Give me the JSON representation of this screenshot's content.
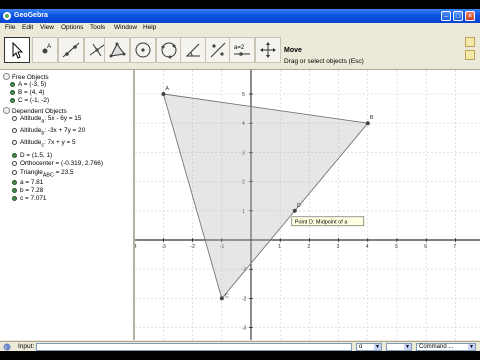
{
  "window": {
    "title": "GeoGebra"
  },
  "menu": [
    "File",
    "Edit",
    "View",
    "Options",
    "Tools",
    "Window",
    "Help"
  ],
  "toolbar": {
    "tools": [
      {
        "name": "move-tool",
        "icon": "arrow-cursor-icon"
      },
      {
        "name": "point-tool",
        "icon": "point-icon"
      },
      {
        "name": "line-tool",
        "icon": "line-through-points-icon"
      },
      {
        "name": "perpendicular-tool",
        "icon": "perpendicular-line-icon"
      },
      {
        "name": "polygon-tool",
        "icon": "polygon-icon"
      },
      {
        "name": "circle-tool",
        "icon": "circle-center-point-icon"
      },
      {
        "name": "circle-arc-tool",
        "icon": "circle-three-points-icon"
      },
      {
        "name": "angle-tool",
        "icon": "angle-icon"
      },
      {
        "name": "reflect-tool",
        "icon": "reflect-about-line-icon"
      },
      {
        "name": "slider-tool",
        "icon": "slider-icon"
      },
      {
        "name": "move-view-tool",
        "icon": "move-graphics-view-icon"
      }
    ],
    "active_title": "Move",
    "active_desc": "Drag or select objects (Esc)"
  },
  "algebra": {
    "free_header": "Free Objects",
    "free": [
      {
        "label": "A",
        "value": "(-3, 5)"
      },
      {
        "label": "B",
        "value": "(4, 4)"
      },
      {
        "label": "C",
        "value": "(-1, -2)"
      }
    ],
    "dependent_header": "Dependent Objects",
    "dependent": [
      {
        "name": "Altitude",
        "sub": "a",
        "eq": ": 5x - 6y = 15",
        "shown": false
      },
      {
        "name": "Altitude",
        "sub": "b",
        "eq": ": -3x + 7y = 20",
        "shown": false
      },
      {
        "name": "Altitude",
        "sub": "c",
        "eq": ": 7x + y = 5",
        "shown": false
      },
      {
        "name": "D",
        "sub": "",
        "eq": " = (1.5, 1)",
        "shown": true
      },
      {
        "name": "Orthocenter",
        "sub": "",
        "eq": " = (-0.319, 2.766)",
        "shown": false
      },
      {
        "name": "Triangle",
        "sub": "ABC",
        "eq": " = 23.5",
        "shown": false
      },
      {
        "name": "a",
        "sub": "",
        "eq": " = 7.81",
        "shown": true
      },
      {
        "name": "b",
        "sub": "",
        "eq": " = 7.28",
        "shown": true
      },
      {
        "name": "c",
        "sub": "",
        "eq": " = 7.071",
        "shown": true
      }
    ]
  },
  "graphics": {
    "x_ticks": [
      "-4",
      "-3",
      "-2",
      "-1",
      "1",
      "2",
      "3",
      "4",
      "5",
      "6",
      "7",
      "8"
    ],
    "y_ticks": [
      "6",
      "5",
      "4",
      "3",
      "2",
      "1",
      "-1",
      "-2",
      "-3"
    ],
    "points": {
      "A": {
        "label": "A",
        "x": -3,
        "y": 5
      },
      "B": {
        "label": "B",
        "x": 4,
        "y": 4
      },
      "C": {
        "label": "C",
        "x": -1,
        "y": -2
      },
      "D": {
        "label": "D",
        "x": 1.5,
        "y": 1
      }
    },
    "tooltip": "Point D: Midpoint of a"
  },
  "inputbar": {
    "label": "Input:",
    "value": "",
    "combo1": "α",
    "combo2": "",
    "combo3": "Command ..."
  },
  "colors": {
    "triangle_fill": "#b8b8b8",
    "grid": "#cfcfcf",
    "titlebar": "#0a54e3",
    "point": "#444444"
  }
}
